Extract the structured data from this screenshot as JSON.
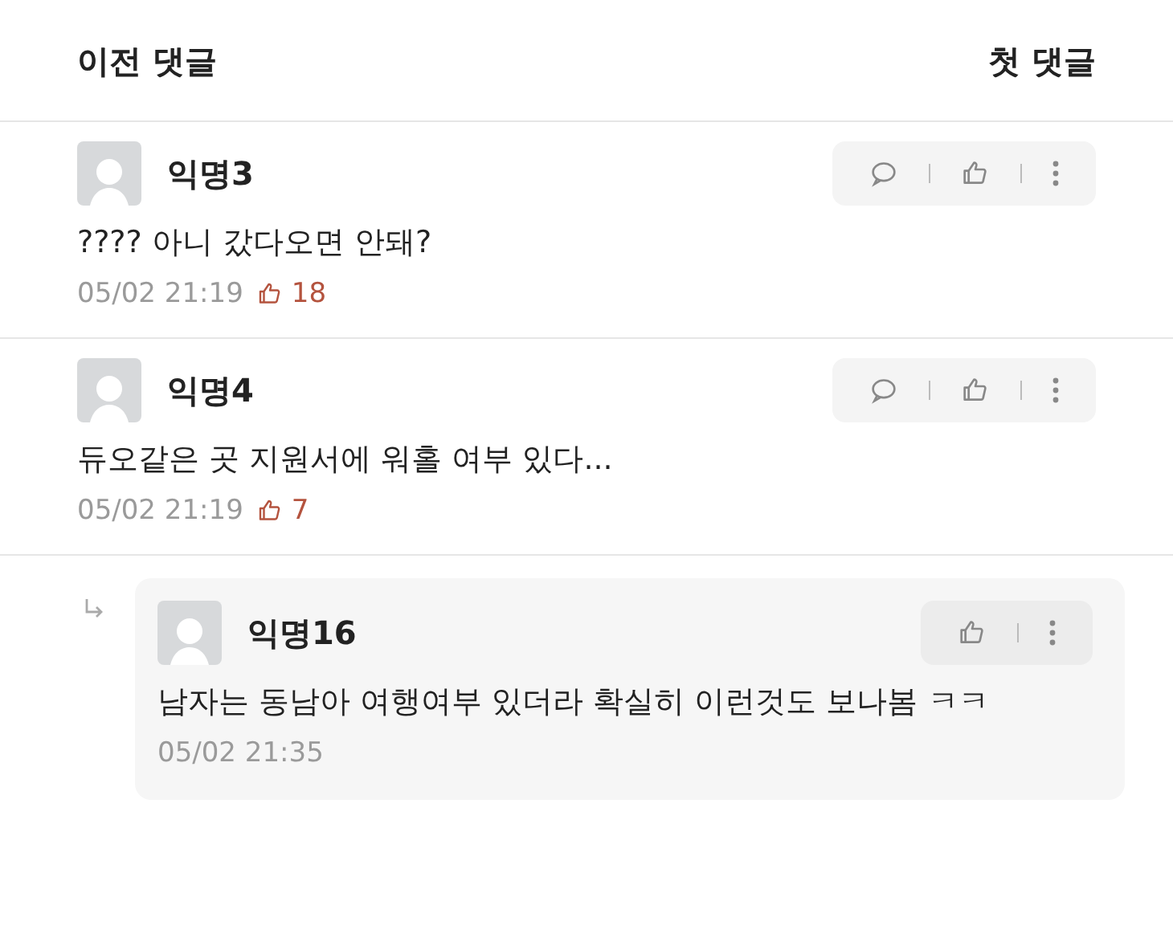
{
  "header": {
    "prev_label": "이전 댓글",
    "first_label": "첫 댓글"
  },
  "comments": [
    {
      "kind": "comment",
      "author": "익명3",
      "text": "???? 아니 갔다오면 안돼?",
      "time": "05/02 21:19",
      "likes": "18"
    },
    {
      "kind": "comment",
      "author": "익명4",
      "text": "듀오같은 곳 지원서에 워홀 여부 있다...",
      "time": "05/02 21:19",
      "likes": "7"
    },
    {
      "kind": "reply",
      "author": "익명16",
      "text": "남자는 동남아 여행여부 있더라 확실히 이런것도 보나봄 ㅋㅋ",
      "time": "05/02 21:35"
    }
  ]
}
